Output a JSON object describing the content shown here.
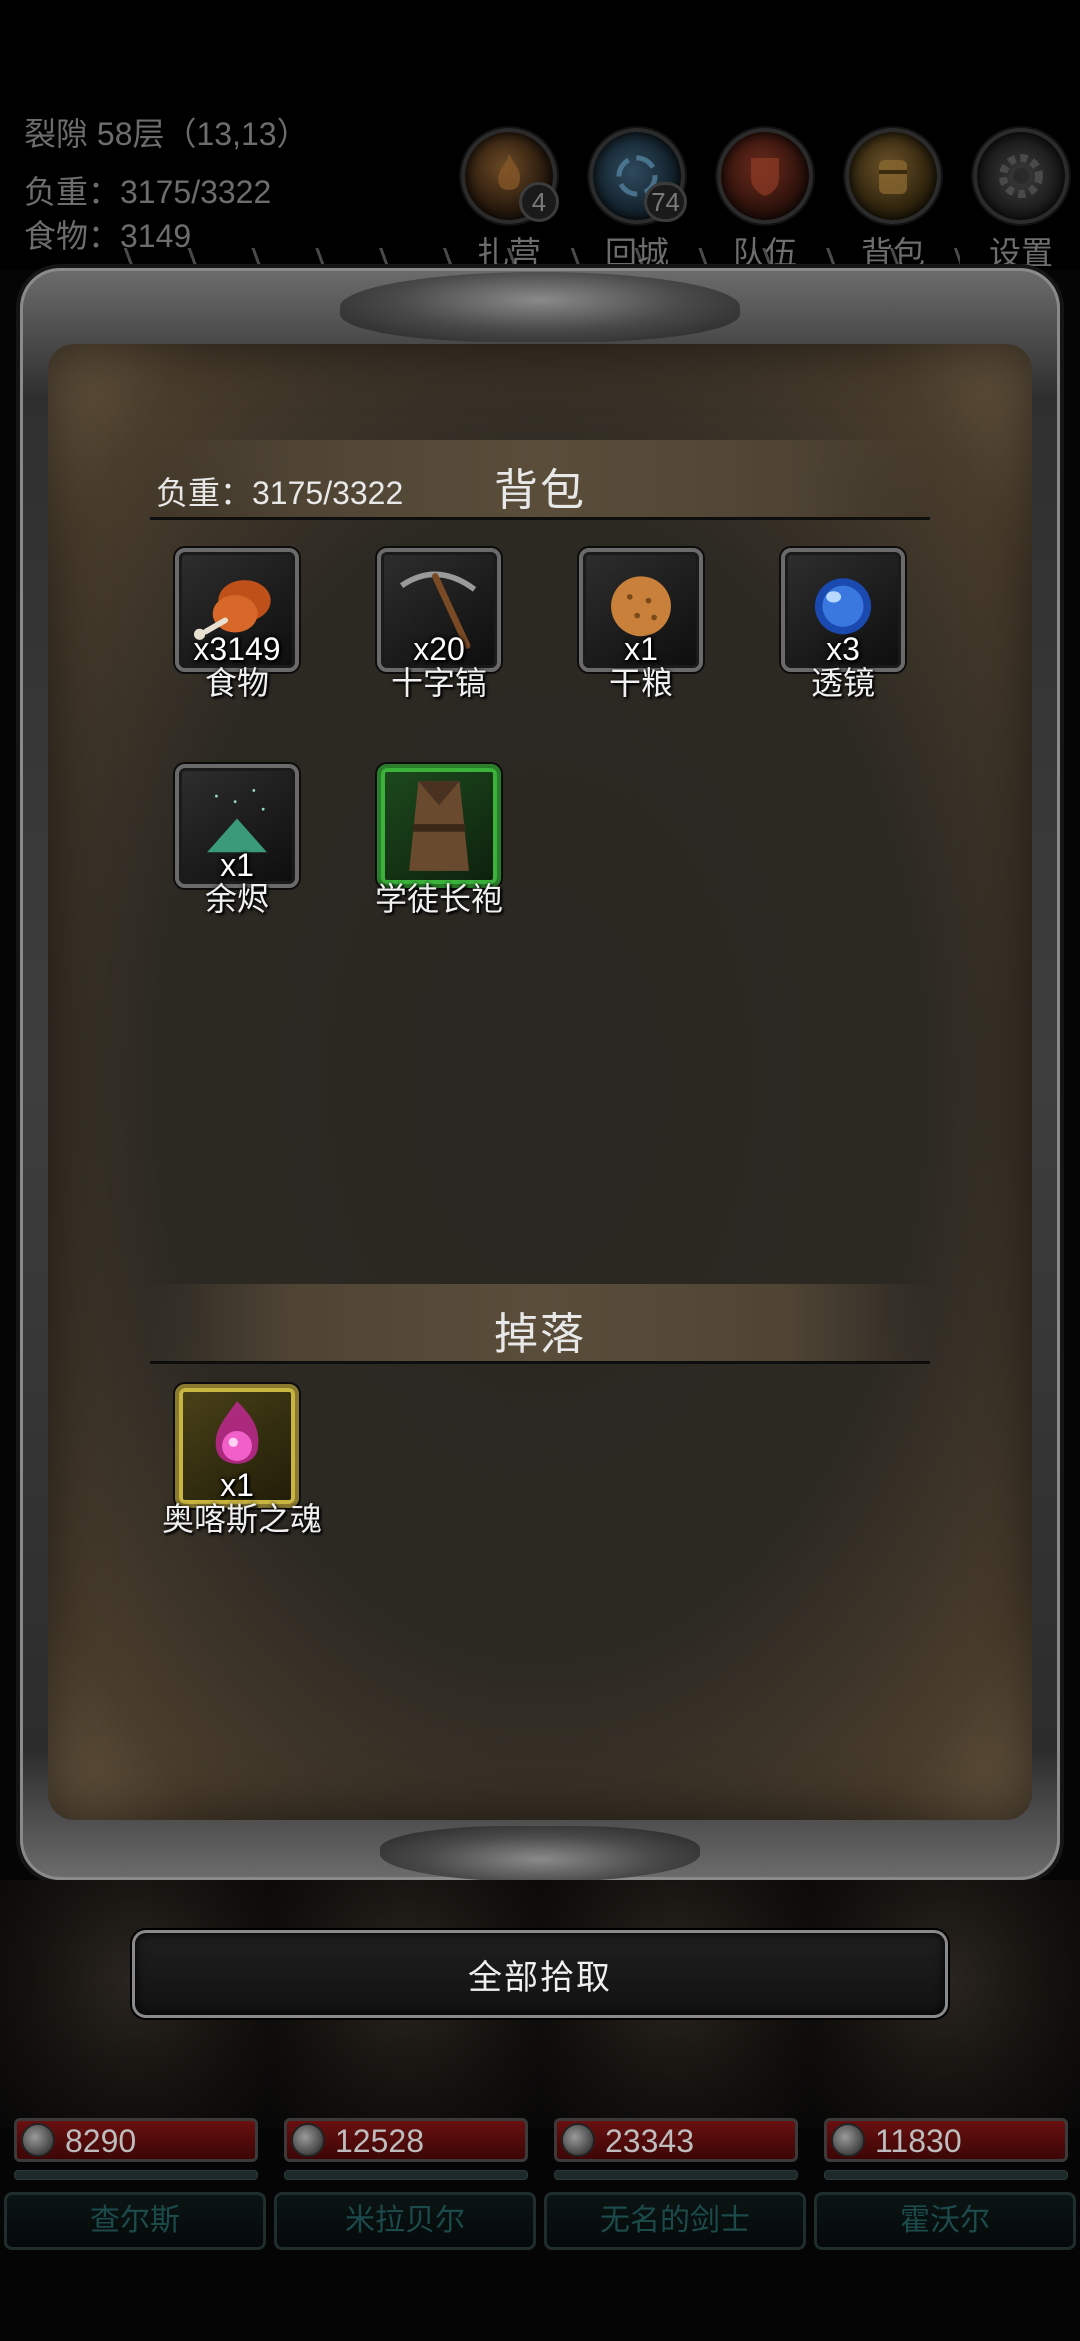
{
  "hud": {
    "location": "裂隙 58层（13,13）",
    "weight": "负重：3175/3322",
    "food": "食物：3149",
    "buttons": [
      {
        "label": "扎营",
        "icon": "campfire-icon",
        "badge": "4"
      },
      {
        "label": "回城",
        "icon": "portal-icon",
        "badge": "74"
      },
      {
        "label": "队伍",
        "icon": "team-shield-icon",
        "badge": ""
      },
      {
        "label": "背包",
        "icon": "backpack-icon",
        "badge": ""
      },
      {
        "label": "设置",
        "icon": "gear-icon",
        "badge": ""
      }
    ]
  },
  "backpack": {
    "title": "背包",
    "weight": "负重：3175/3322",
    "items": [
      {
        "name": "食物",
        "count": "x3149",
        "icon": "meat-icon"
      },
      {
        "name": "十字镐",
        "count": "x20",
        "icon": "pickaxe-icon"
      },
      {
        "name": "干粮",
        "count": "x1",
        "icon": "biscuit-icon"
      },
      {
        "name": "透镜",
        "count": "x3",
        "icon": "lens-icon"
      },
      {
        "name": "余烬",
        "count": "x1",
        "icon": "ember-icon"
      },
      {
        "name": "学徒长袍",
        "count": "",
        "icon": "robe-icon"
      }
    ]
  },
  "drops": {
    "title": "掉落",
    "items": [
      {
        "name": "奥喀斯之魂",
        "count": "x1",
        "icon": "soul-orb-icon"
      }
    ]
  },
  "actions": {
    "pick_all": "全部拾取"
  },
  "party": [
    {
      "name": "查尔斯",
      "hp": "8290"
    },
    {
      "name": "米拉贝尔",
      "hp": "12528"
    },
    {
      "name": "无名的剑士",
      "hp": "23343"
    },
    {
      "name": "霍沃尔",
      "hp": "11830"
    }
  ],
  "colors": {
    "epic_border": "#3bb33b",
    "legendary_border": "#c9b640",
    "hp_bar": "#6a1010",
    "background": "#050505"
  }
}
